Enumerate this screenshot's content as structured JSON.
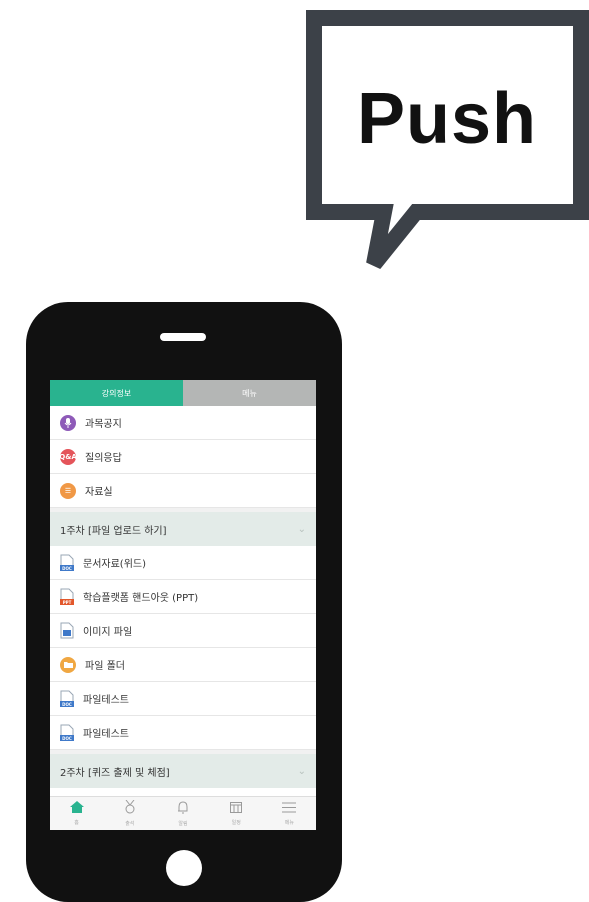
{
  "bubble": {
    "text": "Push"
  },
  "app": {
    "tabs": [
      {
        "label": "강의정보",
        "active": true
      },
      {
        "label": "메뉴",
        "active": false
      }
    ],
    "top_items": [
      {
        "label": "과목공지",
        "icon": "microphone-icon",
        "color": "#8e5ab8",
        "glyph": "🎙"
      },
      {
        "label": "질의응답",
        "icon": "qa-icon",
        "color": "#e4545a",
        "glyph": "Q&A"
      },
      {
        "label": "자료실",
        "icon": "list-icon",
        "color": "#f09846",
        "glyph": "☰"
      }
    ],
    "week1": {
      "title": "1주차 [파일 업로드 하기]",
      "items": [
        {
          "label": "문서자료(위드)",
          "icon": "doc-file-icon",
          "badge": "DOC",
          "badge_color": "#3f79c9"
        },
        {
          "label": "학습플랫폼 핸드아웃 (PPT)",
          "icon": "ppt-file-icon",
          "badge": "PPT",
          "badge_color": "#e2572b"
        },
        {
          "label": "이미지 파일",
          "icon": "image-file-icon",
          "badge": "",
          "badge_color": "#3f79c9"
        },
        {
          "label": "파일 폴더",
          "icon": "folder-icon",
          "badge": "",
          "badge_color": "#f0a742"
        },
        {
          "label": "파일테스트",
          "icon": "doc-file-icon",
          "badge": "DOC",
          "badge_color": "#3f79c9"
        },
        {
          "label": "파일테스트",
          "icon": "doc-file-icon",
          "badge": "DOC",
          "badge_color": "#3f79c9"
        }
      ]
    },
    "week2": {
      "title": "2주차 [퀴즈 출제 및 체점]"
    },
    "bottom_nav": [
      {
        "label": "홈",
        "icon": "home-icon",
        "glyph": "⌂",
        "active": true
      },
      {
        "label": "출석",
        "icon": "medal-icon",
        "glyph": "♁",
        "active": false
      },
      {
        "label": "알림",
        "icon": "bell-icon",
        "glyph": "🔔",
        "active": false
      },
      {
        "label": "일정",
        "icon": "calendar-icon",
        "glyph": "▦",
        "active": false
      },
      {
        "label": "메뉴",
        "icon": "menu-icon",
        "glyph": "☰",
        "active": false
      }
    ]
  }
}
